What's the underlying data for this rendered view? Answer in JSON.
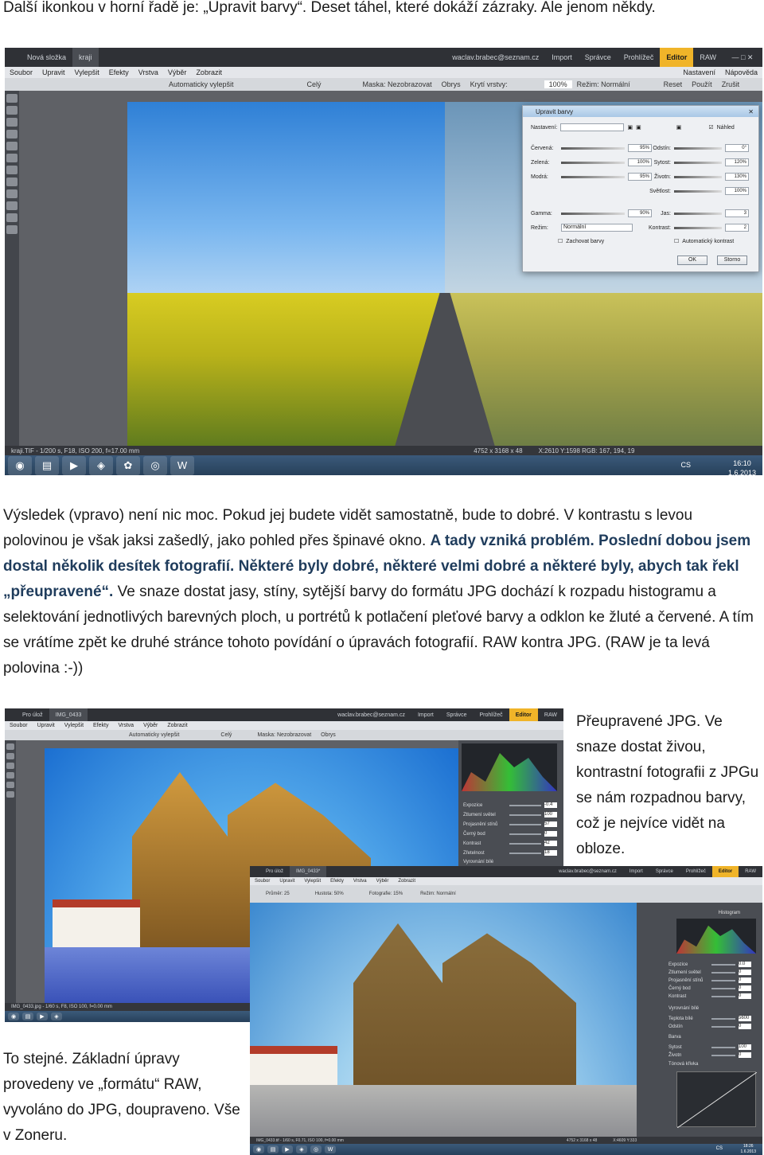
{
  "intro": "Další ikonkou v horní řadě je: „Upravit barvy“. Deset táhel, které dokáží zázraky. Ale jenom někdy.",
  "shot1": {
    "tabs": [
      "Nová složka",
      "kraji"
    ],
    "email": "waclav.brabec@seznam.cz",
    "nav": [
      "Import",
      "Správce",
      "Prohlížeč",
      "Editor",
      "RAW"
    ],
    "nav_right": [
      "Nastavení",
      "Nápověda"
    ],
    "menu": [
      "Soubor",
      "Upravit",
      "Vylepšit",
      "Efekty",
      "Vrstva",
      "Výběr",
      "Zobrazit"
    ],
    "toolbar": [
      "Automaticky vylepšit",
      "Celý",
      "Maska: Nezobrazovat",
      "Obrys",
      "Krytí vrstvy:",
      "100%",
      "Režim: Normální",
      "Reset",
      "Použít",
      "Zrušit"
    ],
    "status_left": "kraji.TIF - 1/200 s, F18, ISO 200, f=17.00 mm",
    "status_mid": "4752 x 3168 x 48",
    "status_right": "X:2610 Y:1598  RGB: 167, 194, 19",
    "lang": "CS",
    "time": "16:10",
    "date": "1.6.2013",
    "dialog": {
      "title": "Upravit barvy",
      "preset": "Nastavení:",
      "preview": "Náhled",
      "left_rows": [
        {
          "label": "Červená:",
          "value": "95%"
        },
        {
          "label": "Zelená:",
          "value": "100%"
        },
        {
          "label": "Modrá:",
          "value": "95%"
        },
        {
          "label": "Gamma:",
          "value": "90%"
        }
      ],
      "mode_label": "Režim:",
      "mode_value": "Normální",
      "keep": "Zachovat barvy",
      "right_rows": [
        {
          "label": "Odstín:",
          "value": "0°"
        },
        {
          "label": "Sytost:",
          "value": "120%"
        },
        {
          "label": "Životn:",
          "value": "130%"
        },
        {
          "label": "Světlost:",
          "value": "100%"
        },
        {
          "label": "Jas:",
          "value": "3"
        },
        {
          "label": "Kontrast:",
          "value": "2"
        }
      ],
      "auto_contrast": "Automatický kontrast",
      "ok": "OK",
      "cancel": "Storno"
    }
  },
  "para1": {
    "s1": "Výsledek (vpravo) není nic moc. Pokud jej budete vidět samostatně, bude to dobré. V kontrastu s levou polovinou je však jaksi zašedlý, jako pohled přes špinavé okno. ",
    "s2": "A tady vzniká problém. Poslední dobou jsem dostal několik desítek fotografií. Některé byly dobré, některé velmi dobré a některé byly, abych tak řekl „přeupravené“.",
    "s3": " Ve snaze dostat jasy, stíny, sytější barvy do formátu JPG dochází k rozpadu histogramu a selektování jednotlivých barevných ploch, u portrétů k potlačení pleťové barvy a odklon ke žluté a červené. A tím se vrátíme zpět ke druhé stránce tohoto povídání o úpravách fotografií.  RAW kontra JPG. (RAW je ta levá polovina :-))"
  },
  "shot2": {
    "tabs": [
      "Pro úlož",
      "IMG_0433"
    ],
    "email": "waclav.brabec@seznam.cz",
    "nav": [
      "Import",
      "Správce",
      "Prohlížeč",
      "Editor",
      "RAW"
    ],
    "menu": [
      "Soubor",
      "Upravit",
      "Vylepšit",
      "Efekty",
      "Vrstva",
      "Výběr",
      "Zobrazit"
    ],
    "toolbar": [
      "Automaticky vylepšit",
      "Celý",
      "Maska: Nezobrazovat",
      "Obrys"
    ],
    "panel": [
      "Expozice",
      "Ztlumení světel",
      "Projasnění stínů",
      "Černý bod",
      "Kontrast",
      "Zřetelnost",
      "Vyrovnání bílé"
    ],
    "panel_values": [
      "-0.4",
      "100",
      "57",
      "0",
      "42",
      "18"
    ],
    "status_left": "IMG_0433.jpg - 1/60 s, F8, ISO 100, f=0.00 mm"
  },
  "caption2": "Přeupravené JPG. Ve snaze dostat živou, kontrastní fotografii z JPGu se nám rozpadnou barvy, což je nejvíce vidět na obloze.",
  "shot3": {
    "tabs": [
      "Pro úlož",
      "IMG_0433*"
    ],
    "email": "waclav.brabec@seznam.cz",
    "nav": [
      "Import",
      "Správce",
      "Prohlížeč",
      "Editor",
      "RAW"
    ],
    "menu": [
      "Soubor",
      "Upravit",
      "Vylepšit",
      "Efekty",
      "Vrstva",
      "Výběr",
      "Zobrazit"
    ],
    "toolbar": [
      "Průměr: 25",
      "Hustota: 50%",
      "Fotografie: 15%",
      "Režim: Normální"
    ],
    "panel_title": "Histogram",
    "panel": [
      "Expozice",
      "Ztlumení světel",
      "Projasnění stínů",
      "Černý bod",
      "Kontrast",
      "Vyrovnání bílé",
      "Teplota bílé",
      "Odstín",
      "Barva",
      "Sytost",
      "Životn",
      "Tónová křivka"
    ],
    "panel_values": [
      "0.0",
      "0",
      "0",
      "0",
      "0",
      "5600",
      "0",
      "100",
      "0"
    ],
    "status_left": "IMG_0433.tif - 1/60 s, F0.71, ISO 100, f=0.00 mm",
    "status_mid": "4752 x 3168 x 48",
    "status_right": "X:4609 Y:333",
    "lang": "CS",
    "time": "18:26",
    "date": "1.6.2013"
  },
  "caption3": "To stejné. Základní úpravy provedeny ve „formátu“ RAW, vyvoláno do JPG, doupraveno. Vše v Zoneru."
}
